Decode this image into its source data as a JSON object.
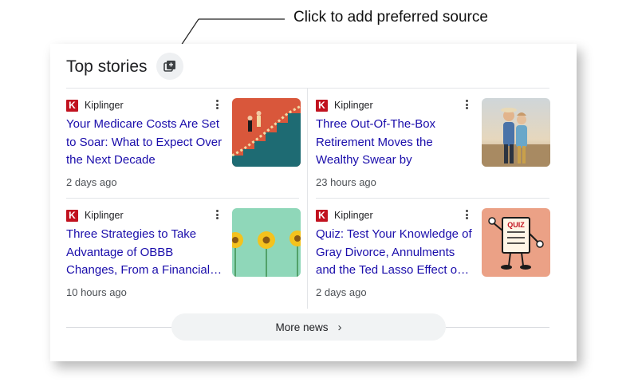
{
  "callout": {
    "text": "Click to add preferred source"
  },
  "card": {
    "title": "Top stories",
    "more_label": "More news",
    "more_chevron": "›"
  },
  "stories": [
    {
      "publisher": "Kiplinger",
      "logo_letter": "K",
      "headline": "Your Medicare Costs Are Set to Soar: What to Expect Over the Next Decade",
      "time": "2 days ago",
      "thumb_icon": "rising-stairs-illustration"
    },
    {
      "publisher": "Kiplinger",
      "logo_letter": "K",
      "headline": "Three Out-Of-The-Box Retirement Moves the Wealthy Swear by",
      "time": "23 hours ago",
      "thumb_icon": "couple-beach-photo"
    },
    {
      "publisher": "Kiplinger",
      "logo_letter": "K",
      "headline": "Three Strategies to Take Advantage of OBBB Changes, From a Financial…",
      "time": "10 hours ago",
      "thumb_icon": "yellow-flowers-photo"
    },
    {
      "publisher": "Kiplinger",
      "logo_letter": "K",
      "headline": "Quiz: Test Your Knowledge of Gray Divorce, Annulments and the Ted Lasso Effect o…",
      "time": "2 days ago",
      "thumb_icon": "quiz-character-illustration",
      "thumb_text": "QUIZ"
    }
  ],
  "colors": {
    "headline": "#1a0dab",
    "publisher_logo": "#c1121f",
    "button_bg": "#f1f3f4"
  }
}
